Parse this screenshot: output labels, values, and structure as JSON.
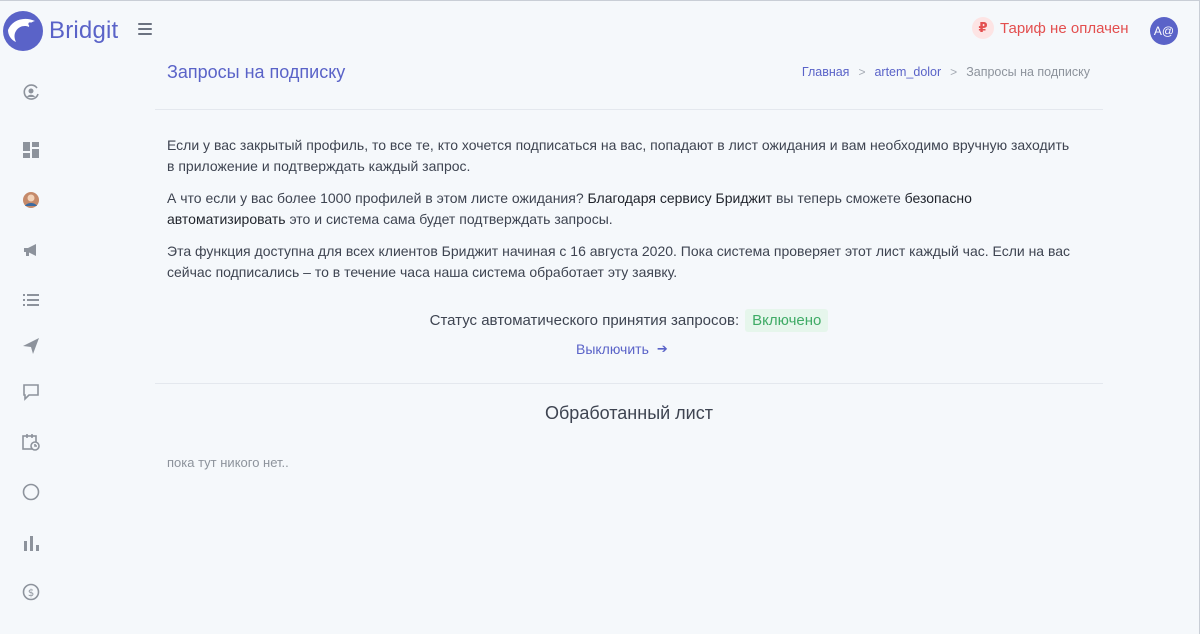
{
  "brand": {
    "name": "Bridgit"
  },
  "header": {
    "tariff_icon": "₽",
    "tariff_text": "Тариф не оплачен",
    "avatar_initials": "A@"
  },
  "sidebar": {
    "items": [
      {
        "name": "profile-sync-icon"
      },
      {
        "name": "dashboard-icon"
      },
      {
        "name": "account-avatar-icon"
      },
      {
        "name": "megaphone-icon"
      },
      {
        "name": "list-icon"
      },
      {
        "name": "paper-plane-icon"
      },
      {
        "name": "chat-icon"
      },
      {
        "name": "calendar-clock-icon"
      },
      {
        "name": "circle-icon"
      },
      {
        "name": "bar-chart-icon"
      },
      {
        "name": "dollar-circle-icon"
      }
    ]
  },
  "page": {
    "title": "Запросы на подписку",
    "breadcrumb": [
      "Главная",
      "artem_dolor",
      "Запросы на подписку"
    ]
  },
  "content": {
    "p1": "Если у вас закрытый профиль, то все те, кто хочется подписаться на вас, попадают в лист ожидания и вам необходимо вручную заходить в приложение и подтверждать каждый запрос.",
    "p2_a": "А что если у вас более 1000 профилей в этом листе ожидания? ",
    "p2_b": "Благодаря сервису Бриджит",
    "p2_c": " вы теперь сможете ",
    "p2_d": "безопасно автоматизировать",
    "p2_e": " это и система сама будет подтверждать запросы.",
    "p3": "Эта функция доступна для всех клиентов Бриджит начиная с 16 августа 2020. Пока система проверяет этот лист каждый час. Если на вас сейчас подписались – то в течение часа наша система обработает эту заявку.",
    "status_label": "Статус автоматического принятия запросов:",
    "status_value": "Включено",
    "disable_label": "Выключить",
    "disable_arrow": "➔",
    "processed_title": "Обработанный лист",
    "empty_text": "пока тут никого нет.."
  },
  "colors": {
    "accent": "#5a63c8",
    "danger": "#e34f4f",
    "success": "#3fab66",
    "background": "#f5f8fb"
  }
}
